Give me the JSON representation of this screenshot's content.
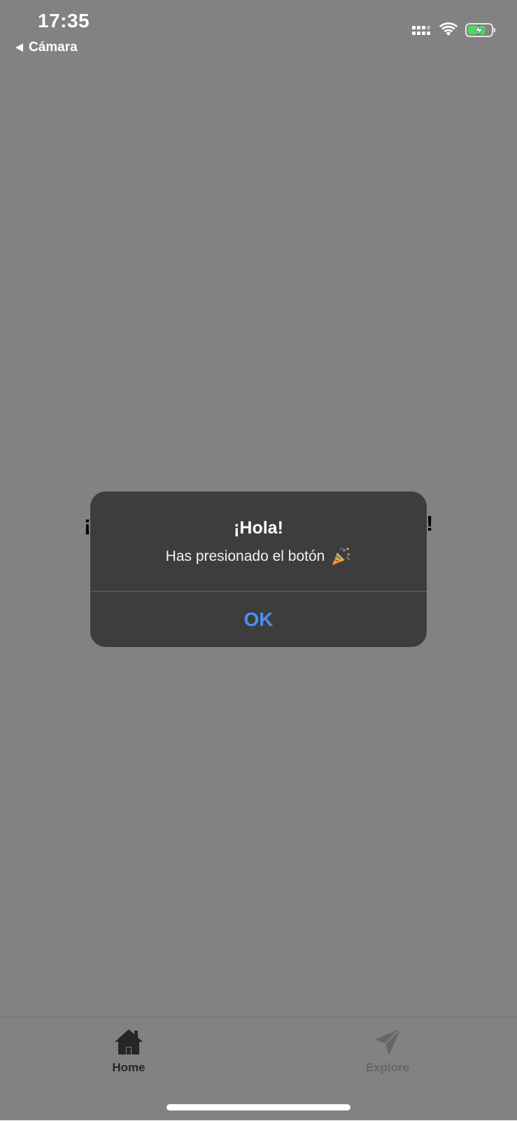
{
  "status_bar": {
    "time": "17:35",
    "back_label": "Cámara"
  },
  "main": {
    "title": "¡Mi primera app con React Native!"
  },
  "alert": {
    "title": "¡Hola!",
    "message": "Has presionado el botón",
    "message_icon": "party-popper-icon",
    "ok_label": "OK"
  },
  "tab_bar": {
    "tabs": [
      {
        "label": "Home",
        "icon": "home-icon",
        "active": true
      },
      {
        "label": "Explore",
        "icon": "paper-plane-icon",
        "active": false
      }
    ]
  },
  "colors": {
    "alert_background": "#3d3d3e",
    "ok_button": "#4b8ef2",
    "battery_green": "#4cd964",
    "overlay": "rgba(0,0,0,0.49)"
  }
}
